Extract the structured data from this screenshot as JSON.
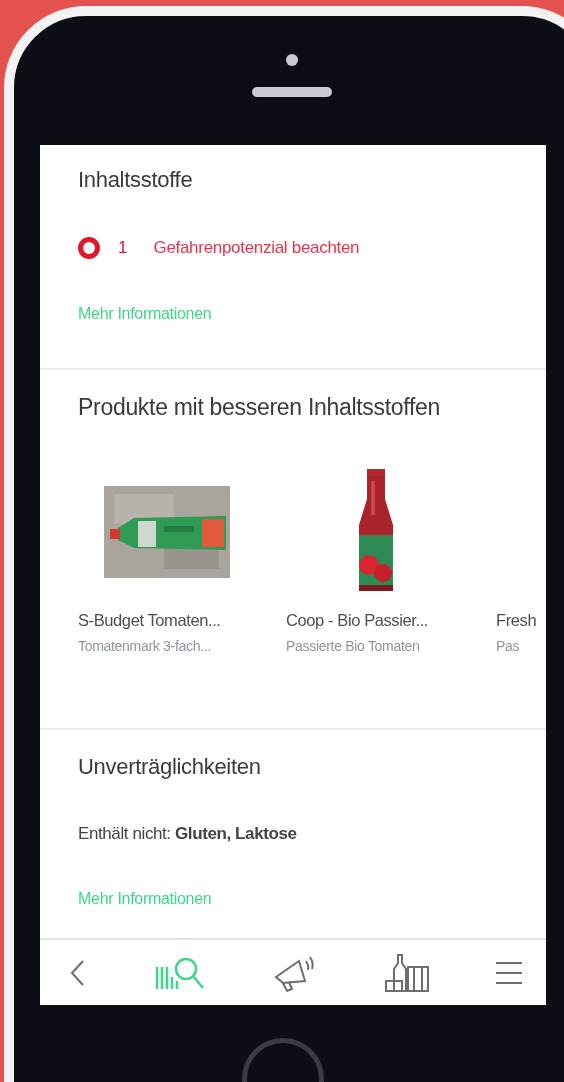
{
  "ingredients": {
    "title": "Inhaltsstoffe",
    "hazard_count": "1",
    "hazard_text": "Gefahrenpotenzial beachten",
    "more_link": "Mehr Informationen"
  },
  "better_products": {
    "title": "Produkte mit besseren Inhaltsstoffen",
    "items": [
      {
        "kind": "tube",
        "name": "S-Budget Tomaten...",
        "subtitle": "Tomatenmark 3-fach..."
      },
      {
        "kind": "bottle",
        "name": "Coop - Bio Passier...",
        "subtitle": "Passierte Bio Tomaten"
      },
      {
        "kind": "none",
        "name": "Fresh",
        "subtitle": "Pas"
      }
    ]
  },
  "intolerances": {
    "title": "Unverträglichkeiten",
    "text": "Enthält nicht: **Gluten, Laktose**",
    "more_link": "Mehr Informationen"
  },
  "nav": [
    {
      "kind": "back",
      "selected": false
    },
    {
      "kind": "scan",
      "selected": true
    },
    {
      "kind": "megaphone",
      "selected": false
    },
    {
      "kind": "products",
      "selected": false
    },
    {
      "kind": "menu",
      "selected": false
    }
  ]
}
